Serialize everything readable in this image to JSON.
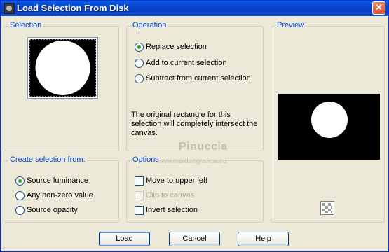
{
  "window": {
    "title": "Load Selection From Disk",
    "close_glyph": "✕"
  },
  "selection": {
    "label": "Selection"
  },
  "operation": {
    "label": "Operation",
    "options": [
      {
        "label": "Replace selection",
        "checked": true
      },
      {
        "label": "Add to current selection",
        "checked": false
      },
      {
        "label": "Subtract from current selection",
        "checked": false
      }
    ],
    "info": "The original rectangle for this selection will completely intersect the canvas."
  },
  "preview": {
    "label": "Preview"
  },
  "create_from": {
    "label": "Create selection from:",
    "options": [
      {
        "label": "Source luminance",
        "checked": true
      },
      {
        "label": "Any non-zero value",
        "checked": false
      },
      {
        "label": "Source opacity",
        "checked": false
      }
    ]
  },
  "options": {
    "label": "Options",
    "items": [
      {
        "label": "Move to upper left",
        "checked": false,
        "enabled": true
      },
      {
        "label": "Clip to canvas",
        "checked": false,
        "enabled": false
      },
      {
        "label": "Invert selection",
        "checked": false,
        "enabled": true
      }
    ]
  },
  "watermark": {
    "name": "Pinuccia",
    "site": "www.maidiregrafica.eu"
  },
  "buttons": {
    "load": "Load",
    "cancel": "Cancel",
    "help": "Help"
  },
  "colors": {
    "title_bar": "#0a4fd8",
    "group_label": "#0046d5",
    "radio_dot": "#21a121"
  }
}
